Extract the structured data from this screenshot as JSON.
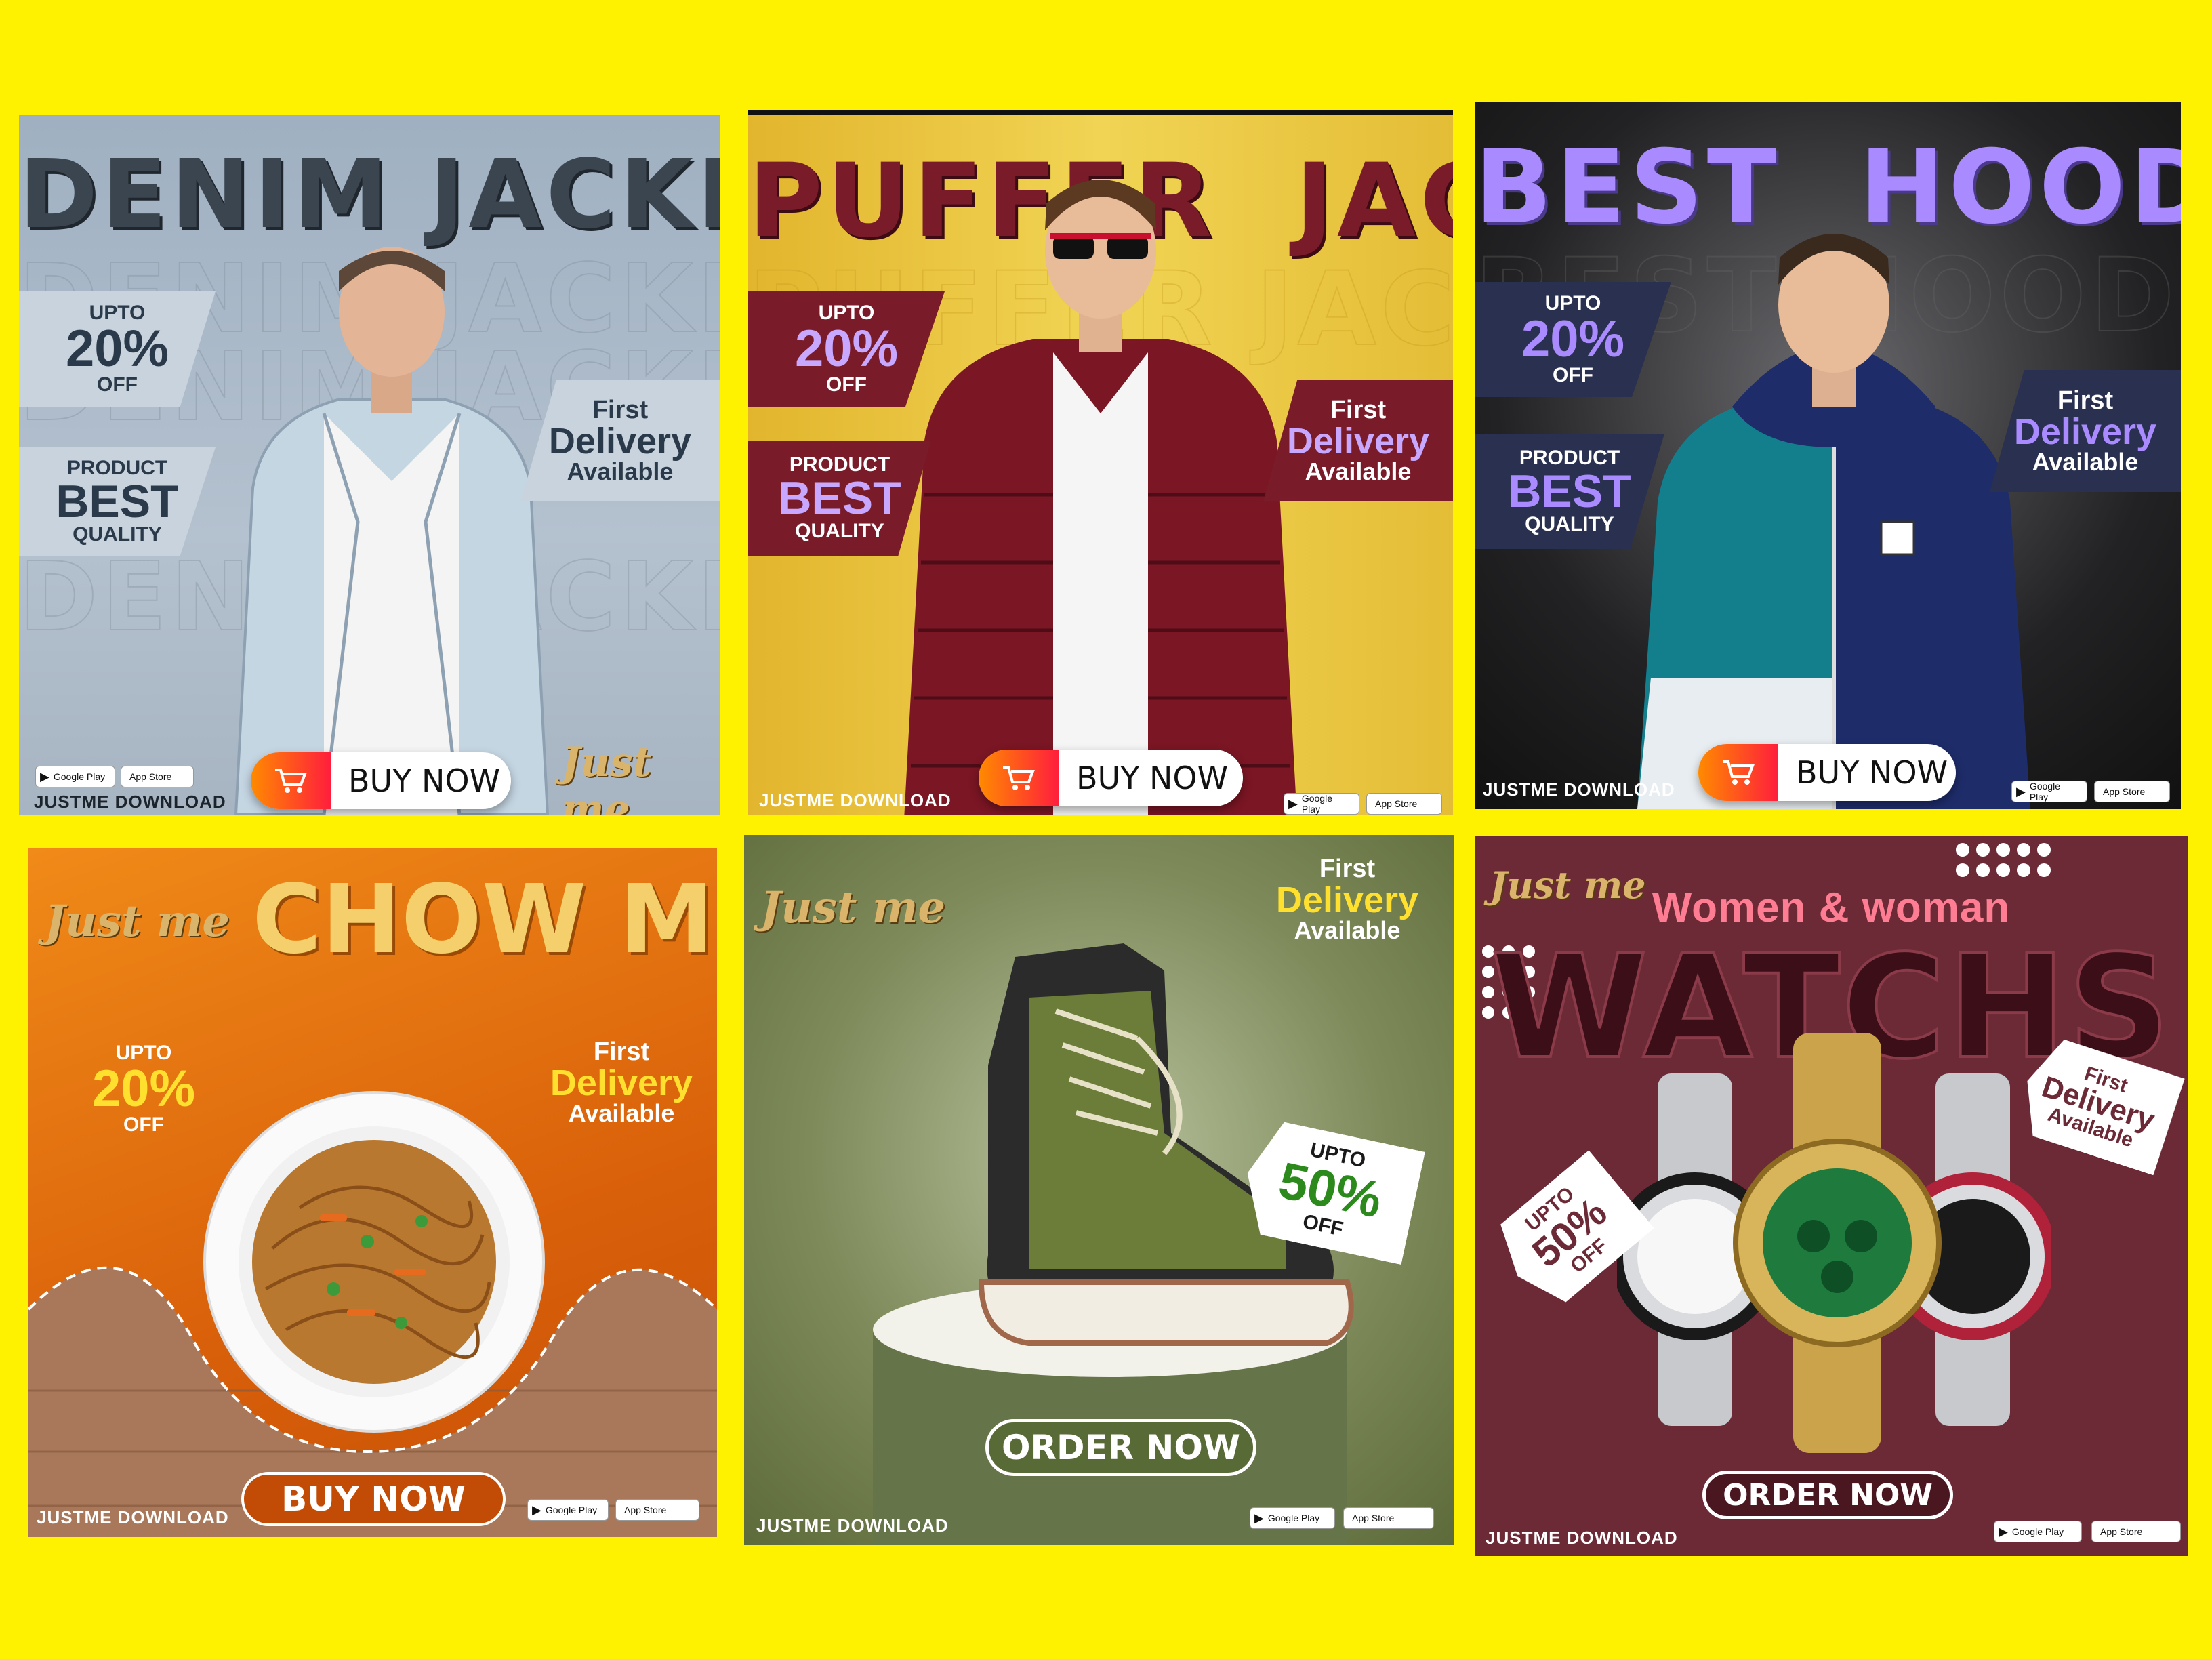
{
  "footer_label": "JUSTME DOWNLOAD",
  "store_badges": {
    "google": "Google Play",
    "apple": "App Store"
  },
  "brand_logo": "Just me",
  "colors": {
    "background": "#fff200"
  },
  "cards": [
    {
      "title_left": "DENIM",
      "title_right": "JACKET",
      "discount": {
        "upto": "UPTO",
        "value": "20%",
        "off": "OFF"
      },
      "quality": {
        "top": "PRODUCT",
        "main": "BEST",
        "bottom": "QUALITY"
      },
      "delivery": {
        "line1": "First",
        "line2": "Delivery",
        "line3": "Available"
      },
      "cta": "BUY NOW",
      "bg": "#a9b7c6"
    },
    {
      "title_left": "PUFFER",
      "title_right": "JACKE",
      "discount": {
        "upto": "UPTO",
        "value": "20%",
        "off": "OFF"
      },
      "quality": {
        "top": "PRODUCT",
        "main": "BEST",
        "bottom": "QUALITY"
      },
      "delivery": {
        "line1": "First",
        "line2": "Delivery",
        "line3": "Available"
      },
      "cta": "BUY NOW",
      "bg": "#e7c43a"
    },
    {
      "title_left": "BEST",
      "title_right": "HOODIES",
      "discount": {
        "upto": "UPTO",
        "value": "20%",
        "off": "OFF"
      },
      "quality": {
        "top": "PRODUCT",
        "main": "BEST",
        "bottom": "QUALITY"
      },
      "delivery": {
        "line1": "First",
        "line2": "Delivery",
        "line3": "Available"
      },
      "cta": "BUY NOW",
      "bg": "#1a1a1c"
    },
    {
      "title": "CHOW MEIN",
      "discount": {
        "upto": "UPTO",
        "value": "20%",
        "off": "OFF"
      },
      "delivery": {
        "line1": "First",
        "line2": "Delivery",
        "line3": "Available"
      },
      "cta": "BUY NOW",
      "bg": "#e8730f"
    },
    {
      "delivery": {
        "line1": "First",
        "line2": "Delivery",
        "line3": "Available"
      },
      "tag": {
        "upto": "UPTO",
        "value": "50%",
        "off": "OFF"
      },
      "cta": "ORDER NOW",
      "bg": "#6f7a4d"
    },
    {
      "subtitle": "Women & woman",
      "title": "WATCHS",
      "tag": {
        "upto": "UPTO",
        "value": "50%",
        "off": "OFF"
      },
      "delivery": {
        "line1": "First",
        "line2": "Delivery",
        "line3": "Available"
      },
      "cta": "ORDER NOW",
      "bg": "#6b2a36"
    }
  ]
}
